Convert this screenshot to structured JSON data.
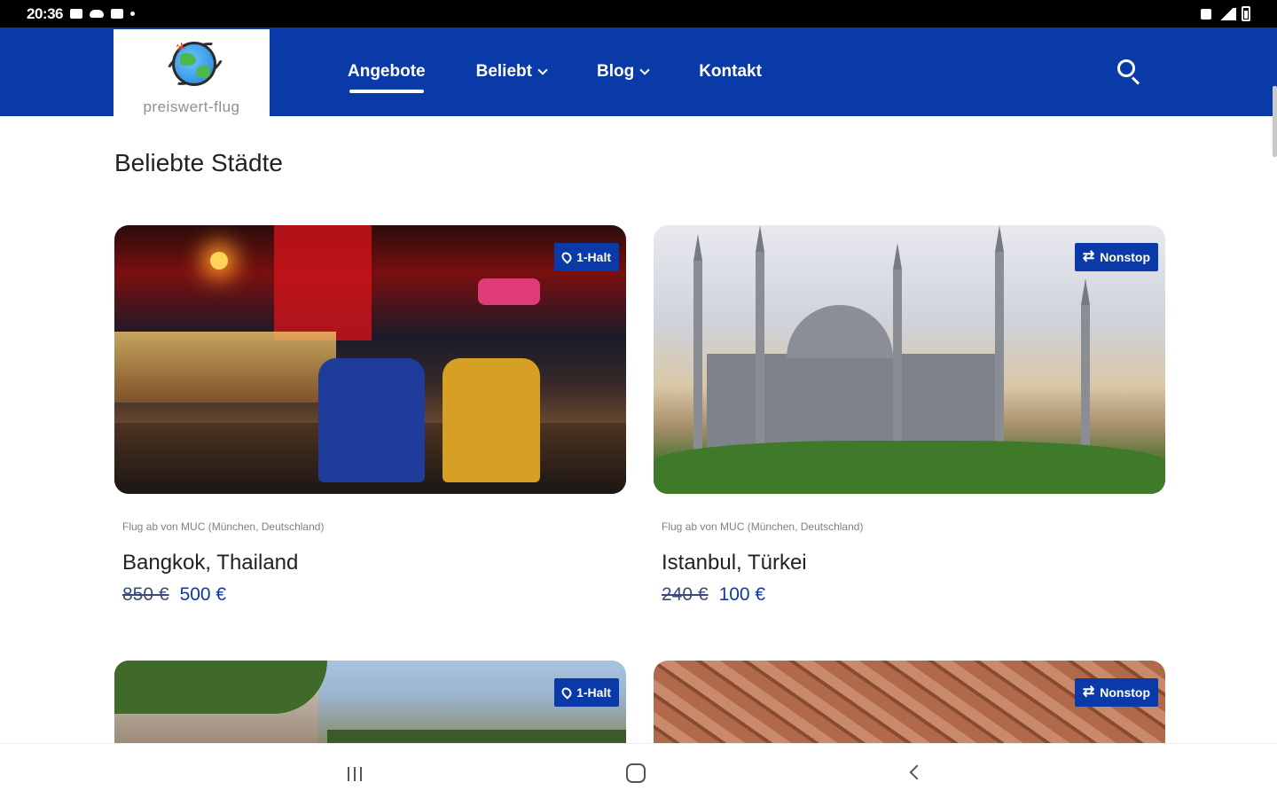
{
  "status_bar": {
    "time": "20:36"
  },
  "brand": {
    "logo_text": "preiswert-flug",
    "primary_color": "#0a3aa8"
  },
  "nav": {
    "items": [
      {
        "label": "Angebote",
        "active": true
      },
      {
        "label": "Beliebt"
      },
      {
        "label": "Blog"
      },
      {
        "label": "Kontakt"
      }
    ]
  },
  "section": {
    "title": "Beliebte Städte"
  },
  "cards": [
    {
      "badge": "1-Halt",
      "subtitle": "Flug ab von MUC (München, Deutschland)",
      "city": "Bangkok, Thailand",
      "old_price": "850 €",
      "price": "500 €"
    },
    {
      "badge": "Nonstop",
      "subtitle": "Flug ab von MUC (München, Deutschland)",
      "city": "Istanbul, Türkei",
      "old_price": "240 €",
      "price": "100 €"
    },
    {
      "badge": "1-Halt"
    },
    {
      "badge": "Nonstop"
    }
  ]
}
